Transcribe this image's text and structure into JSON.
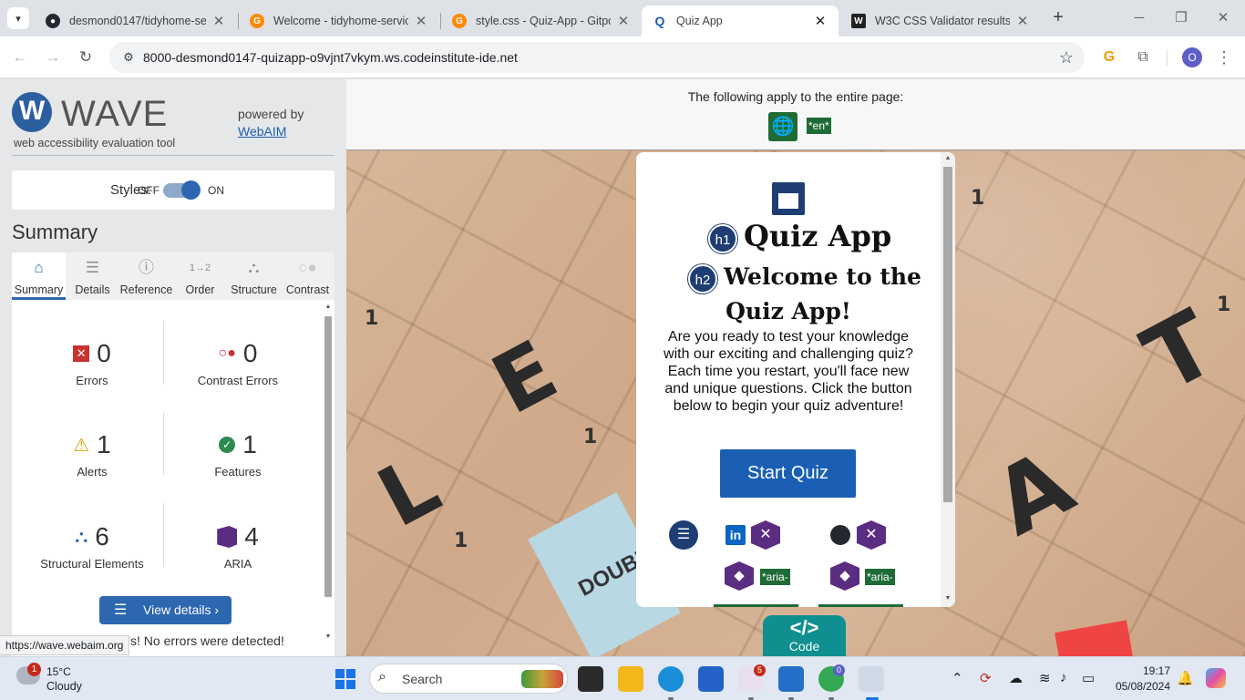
{
  "browser": {
    "tabs": [
      {
        "title": "desmond0147/tidyhome-se",
        "favicon": "github-icon"
      },
      {
        "title": "Welcome - tidyhome-service",
        "favicon": "gitpod-icon"
      },
      {
        "title": "style.css - Quiz-App - Gitpod",
        "favicon": "gitpod-icon"
      },
      {
        "title": "Quiz App",
        "favicon": "quiz-icon",
        "active": true
      },
      {
        "title": "W3C CSS Validator results fo",
        "favicon": "w3c-icon"
      }
    ],
    "url": "8000-desmond0147-quizapp-o9vjnt7vkym.ws.codeinstitute-ide.net",
    "status_url": "https://wave.webaim.org",
    "profile_initial": "O"
  },
  "wave": {
    "logo_letter": "W",
    "brand": "WAVE",
    "subtitle": "web accessibility evaluation tool",
    "powered_by": "powered by",
    "webaim_link": "WebAIM",
    "styles_label": "Styles:",
    "styles_off": "OFF",
    "styles_on": "ON",
    "summary_title": "Summary",
    "tabs": [
      "Summary",
      "Details",
      "Reference",
      "Order",
      "Structure",
      "Contrast"
    ],
    "stats": {
      "errors": {
        "value": "0",
        "label": "Errors"
      },
      "contrast": {
        "value": "0",
        "label": "Contrast Errors"
      },
      "alerts": {
        "value": "1",
        "label": "Alerts"
      },
      "features": {
        "value": "1",
        "label": "Features"
      },
      "structural": {
        "value": "6",
        "label": "Structural Elements"
      },
      "aria": {
        "value": "4",
        "label": "ARIA"
      }
    },
    "view_details": "View details ›",
    "no_errors": "s! No errors were detected!"
  },
  "page": {
    "banner_text": "The following apply to the entire page:",
    "lang_tag": "*en*",
    "quiz": {
      "h1_tag": "h1",
      "h2_tag": "h2",
      "title": "Quiz App",
      "welcome_line1": "Welcome to the",
      "welcome_line2": "Quiz App!",
      "description": "Are you ready to test your knowledge with our exciting and challenging quiz? Each time you restart, you'll face new and unique questions. Click the button below to begin your quiz adventure!",
      "start_button": "Start Quiz",
      "aria_tag_1": "*aria-",
      "aria_tag_2": "*aria-"
    },
    "code_tab": {
      "icon": "</>",
      "label": "Code"
    },
    "tiles": {
      "l": "L",
      "e": "E",
      "a": "A",
      "t": "T",
      "double_letter": "DOUBLE LETTER"
    }
  },
  "taskbar": {
    "weather_temp": "15°C",
    "weather_cond": "Cloudy",
    "weather_badge": "1",
    "search_placeholder": "Search",
    "slack_badge": "5",
    "chrome_badge": "0",
    "time": "19:17",
    "date": "05/08/2024"
  }
}
